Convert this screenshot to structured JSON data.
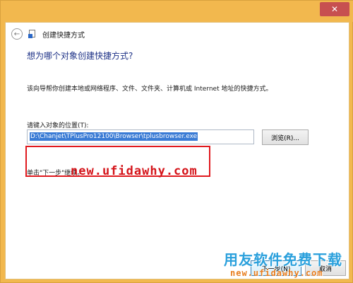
{
  "window": {
    "title": "创建快捷方式",
    "close_glyph": "✕",
    "back_glyph": "←"
  },
  "content": {
    "heading": "想为哪个对象创建快捷方式?",
    "description": "该向导帮你创建本地或网络程序、文件、文件夹、计算机或 Internet 地址的快捷方式。",
    "location_label": "请键入对象的位置(T):",
    "location_value": "D:\\Chanjet\\TPlusPro12100\\Browser\\tplusbrowser.exe",
    "browse_label": "浏览(R)...",
    "hint": "单击\"下一步\"继续。"
  },
  "footer": {
    "next_label": "下一步(N)",
    "cancel_label": "取消"
  },
  "watermarks": {
    "mid_url": "new.ufidawhy.com",
    "brand": "用友软件免费下载",
    "bottom_url": "new.ufidawhy.com"
  },
  "colors": {
    "frame": "#f2b84e",
    "heading": "#1e3287",
    "selection": "#3a7bd5",
    "highlight": "#e0191e"
  }
}
